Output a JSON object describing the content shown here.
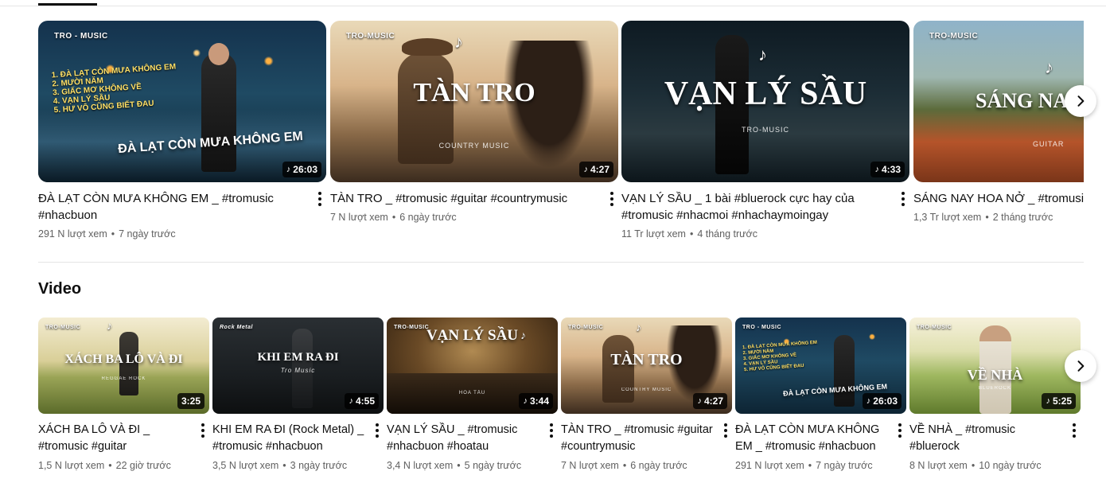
{
  "top_shelf": {
    "videos": [
      {
        "title": "ĐÀ LẠT CÒN MƯA KHÔNG EM _ #tromusic #nhacbuon",
        "views": "291 N lượt xem",
        "age": "7 ngày trước",
        "duration": "26:03",
        "thumb_brand": "TRO - MUSIC",
        "thumb_caption": "ĐÀ LẠT CÒN MƯA KHÔNG EM",
        "thumb_list": [
          "1. ĐÀ LẠT CÒN MƯA KHÔNG EM",
          "2. MƯỜI NĂM",
          "3. GIẤC MƠ KHÔNG VỀ",
          "4. VẠN LÝ SẦU",
          "5. HƯ VÔ CŨNG BIẾT ĐAU"
        ]
      },
      {
        "title": "TÀN TRO _ #tromusic #guitar #countrymusic",
        "views": "7 N lượt xem",
        "age": "6 ngày trước",
        "duration": "4:27",
        "thumb_brand": "TRO-MUSIC",
        "thumb_caption": "TÀN TRO",
        "thumb_sub": "COUNTRY MUSIC"
      },
      {
        "title": "VẠN LÝ SẦU _ 1 bài #bluerock cực hay của #tromusic #nhacmoi #nhachaymoingay",
        "views": "11 Tr lượt xem",
        "age": "4 tháng trước",
        "duration": "4:33",
        "thumb_caption": "VẠN LÝ SẦU",
        "thumb_sub": "TRO-MUSIC"
      },
      {
        "title": "SÁNG NAY HOA NỞ _ #tromusic #",
        "views": "1,3 Tr lượt xem",
        "age": "2 tháng trước",
        "thumb_brand": "TRO-MUSIC",
        "thumb_caption": "SÁNG NAY",
        "thumb_sub": "GUITAR"
      }
    ]
  },
  "video_section": {
    "title": "Video",
    "videos": [
      {
        "title": "XÁCH BA LÔ VÀ ĐI _ #tromusic #guitar",
        "views": "1,5 N lượt xem",
        "age": "22 giờ trước",
        "duration": "3:25",
        "thumb_brand": "TRO-MUSIC",
        "thumb_caption": "XÁCH BA LÔ VÀ ĐI",
        "thumb_sub": "REGGAE ROCK"
      },
      {
        "title": "KHI EM RA ĐI (Rock Metal) _ #tromusic #nhacbuon",
        "views": "3,5 N lượt xem",
        "age": "3 ngày trước",
        "duration": "4:55",
        "thumb_brand": "Rock Metal",
        "thumb_caption": "KHI EM RA ĐI",
        "thumb_sub": "Tro Music"
      },
      {
        "title": "VẠN LÝ SẦU _ #tromusic #nhacbuon #hoatau",
        "views": "3,4 N lượt xem",
        "age": "5 ngày trước",
        "duration": "3:44",
        "thumb_brand": "TRO-MUSIC",
        "thumb_caption": "VẠN LÝ SẦU",
        "thumb_sub": "HÒA TẤU"
      },
      {
        "title": "TÀN TRO _ #tromusic #guitar #countrymusic",
        "views": "7 N lượt xem",
        "age": "6 ngày trước",
        "duration": "4:27",
        "thumb_brand": "TRO-MUSIC",
        "thumb_caption": "TÀN TRO",
        "thumb_sub": "COUNTRY MUSIC"
      },
      {
        "title": "ĐÀ LẠT CÒN MƯA KHÔNG EM _ #tromusic #nhacbuon",
        "views": "291 N lượt xem",
        "age": "7 ngày trước",
        "duration": "26:03",
        "thumb_brand": "TRO - MUSIC",
        "thumb_caption": "ĐÀ LẠT CÒN MƯA KHÔNG EM",
        "thumb_list": [
          "1. ĐÀ LẠT CÒN MƯA KHÔNG EM",
          "2. MƯỜI NĂM",
          "3. GIẤC MƠ KHÔNG VỀ",
          "4. VẠN LÝ SẦU",
          "5. HƯ VÔ CŨNG BIẾT ĐAU"
        ]
      },
      {
        "title": "VỀ NHÀ _ #tromusic #bluerock",
        "views": "8 N lượt xem",
        "age": "10 ngày trước",
        "duration": "5:25",
        "thumb_brand": "TRO-MUSIC",
        "thumb_caption": "VỀ NHÀ",
        "thumb_sub": "BLUEROCK"
      }
    ]
  },
  "icons": {
    "next": "chevron-right-icon",
    "more": "more-vert-icon",
    "duration_note": "music-note-icon"
  },
  "glyphs": {
    "note": "♪",
    "dot": "•"
  },
  "colors": {
    "text_primary": "#0f0f0f",
    "text_secondary": "#606060",
    "divider": "#e5e5e5",
    "badge_bg": "#000000"
  }
}
